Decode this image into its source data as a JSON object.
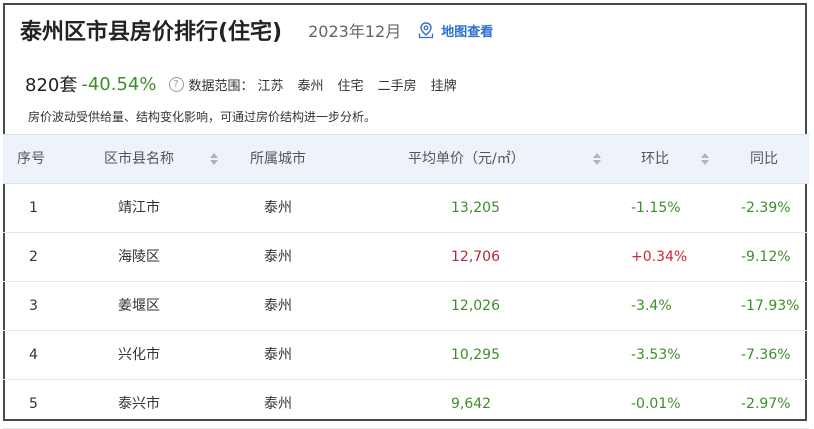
{
  "header": {
    "title": "泰州区市县房价排行(住宅)",
    "date": "2023年12月",
    "map_link": "地图查看"
  },
  "stats": {
    "count": "820套",
    "change": "-40.54%",
    "help_icon_glyph": "?",
    "scope_label": "数据范围：",
    "scope": [
      "江苏",
      "泰州",
      "住宅",
      "二手房",
      "挂牌"
    ]
  },
  "note": "房价波动受供给量、结构变化影响，可通过房价结构进一步分析。",
  "table": {
    "columns": [
      "序号",
      "区市县名称",
      "所属城市",
      "平均单价（元/㎡）",
      "环比",
      "同比"
    ],
    "rows": [
      {
        "idx": "1",
        "name": "靖江市",
        "city": "泰州",
        "price": "13,205",
        "mom": "-1.15%",
        "yoy": "-2.39%",
        "price_up": false,
        "mom_up": false
      },
      {
        "idx": "2",
        "name": "海陵区",
        "city": "泰州",
        "price": "12,706",
        "mom": "+0.34%",
        "yoy": "-9.12%",
        "price_up": true,
        "mom_up": true
      },
      {
        "idx": "3",
        "name": "姜堰区",
        "city": "泰州",
        "price": "12,026",
        "mom": "-3.4%",
        "yoy": "-17.93%",
        "price_up": false,
        "mom_up": false
      },
      {
        "idx": "4",
        "name": "兴化市",
        "city": "泰州",
        "price": "10,295",
        "mom": "-3.53%",
        "yoy": "-7.36%",
        "price_up": false,
        "mom_up": false
      },
      {
        "idx": "5",
        "name": "泰兴市",
        "city": "泰州",
        "price": "9,642",
        "mom": "-0.01%",
        "yoy": "-2.97%",
        "price_up": false,
        "mom_up": false
      }
    ]
  },
  "colors": {
    "down": "#3e8e2c",
    "up": "#d0283b",
    "link": "#2f6fd1",
    "header_bg": "#eef3fb"
  }
}
